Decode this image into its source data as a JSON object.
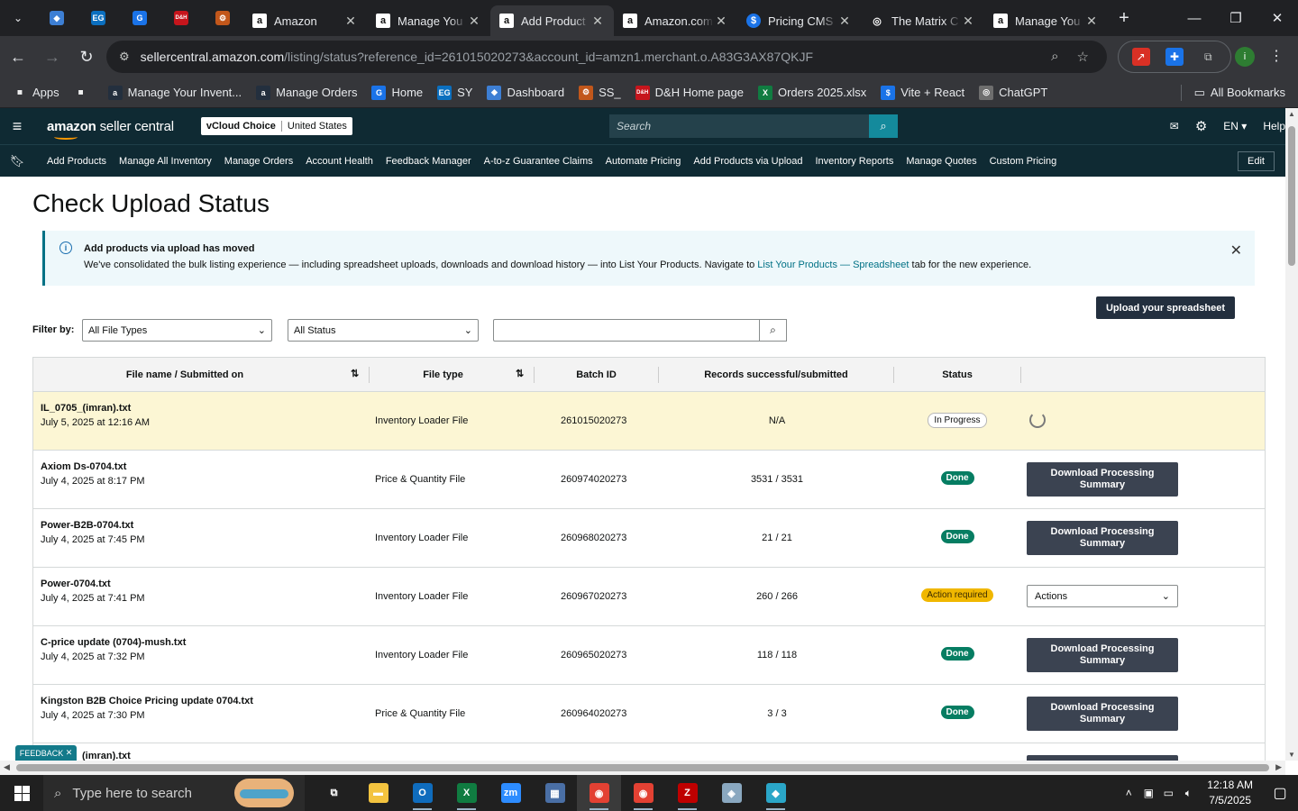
{
  "browser": {
    "tabs": [
      {
        "title": "Amazon",
        "favicon": "amazon-a",
        "active": false
      },
      {
        "title": "Manage You",
        "favicon": "amazon-a",
        "active": false
      },
      {
        "title": "Add Product",
        "favicon": "amazon-a",
        "active": true
      },
      {
        "title": "Amazon.com",
        "favicon": "amazon-a",
        "active": false
      },
      {
        "title": "Pricing CMS",
        "favicon": "dollar-circle",
        "active": false
      },
      {
        "title": "The Matrix C",
        "favicon": "openai",
        "active": false
      },
      {
        "title": "Manage You",
        "favicon": "amazon-a",
        "active": false
      }
    ],
    "pinned_tabs": [
      {
        "name": "pinned-diamond-icon",
        "glyph": "◆",
        "color": "#3d7fd4"
      },
      {
        "name": "pinned-ec-icon",
        "glyph": "EG",
        "color": "#0b6fbf"
      },
      {
        "name": "pinned-g-icon",
        "glyph": "G",
        "color": "#1a73e8"
      },
      {
        "name": "pinned-dh-icon",
        "glyph": "D&H",
        "color": "#c6151c"
      },
      {
        "name": "pinned-ss-icon",
        "glyph": "⚙",
        "color": "#c2571b"
      }
    ],
    "url_host": "sellercentral.amazon.com",
    "url_path": "/listing/status?reference_id=261015020273&account_id=amzn1.merchant.o.A83G3AX87QKJF",
    "bookmarks": [
      {
        "label": "Apps",
        "icon": "grid",
        "color": "#5f6368"
      },
      {
        "label": "",
        "icon": "grid-4",
        "color": "#5f6368"
      },
      {
        "label": "Manage Your Invent...",
        "icon": "a",
        "color": "#232f3e"
      },
      {
        "label": "Manage Orders",
        "icon": "a",
        "color": "#232f3e"
      },
      {
        "label": "Home",
        "icon": "G",
        "color": "#1a73e8"
      },
      {
        "label": "SY",
        "icon": "EG",
        "color": "#0b6fbf"
      },
      {
        "label": "Dashboard",
        "icon": "◆",
        "color": "#3d7fd4"
      },
      {
        "label": "SS_",
        "icon": "⚙",
        "color": "#c2571b"
      },
      {
        "label": "D&H Home page",
        "icon": "D&H",
        "color": "#c6151c"
      },
      {
        "label": "Orders 2025.xlsx",
        "icon": "X",
        "color": "#107c41"
      },
      {
        "label": "Vite + React",
        "icon": "$",
        "color": "#1a73e8"
      },
      {
        "label": "ChatGPT",
        "icon": "◎",
        "color": "#6e6e6e"
      }
    ],
    "all_bookmarks_label": "All Bookmarks"
  },
  "header": {
    "logo_bold": "amazon",
    "logo_rest": " seller central",
    "store_name": "vCloud Choice",
    "marketplace": "United States",
    "search_placeholder": "Search",
    "lang": "EN",
    "help": "Help"
  },
  "nav": {
    "items": [
      "Add Products",
      "Manage All Inventory",
      "Manage Orders",
      "Account Health",
      "Feedback Manager",
      "A-to-z Guarantee Claims",
      "Automate Pricing",
      "Add Products via Upload",
      "Inventory Reports",
      "Manage Quotes",
      "Custom Pricing"
    ],
    "edit": "Edit"
  },
  "page": {
    "title": "Check Upload Status",
    "alert_title": "Add products via upload has moved",
    "alert_body_pre": "We've consolidated the bulk listing experience — including spreadsheet uploads, downloads and download history — into List Your Products. Navigate to ",
    "alert_link": "List Your Products — Spreadsheet",
    "alert_body_post": " tab for the new experience.",
    "upload_button": "Upload your spreadsheet",
    "filter_label": "Filter by:",
    "file_type_filter": "All File Types",
    "status_filter": "All Status",
    "search_value": ""
  },
  "table": {
    "headers": [
      "File name / Submitted on",
      "File type",
      "Batch ID",
      "Records successful/submitted",
      "Status"
    ],
    "rows": [
      {
        "name": "IL_0705_(imran).txt",
        "date": "July 5, 2025 at 12:16 AM",
        "type": "Inventory Loader File",
        "batch": "261015020273",
        "records": "N/A",
        "status": "In Progress",
        "status_kind": "progress",
        "action": "spinner"
      },
      {
        "name": "Axiom Ds-0704.txt",
        "date": "July 4, 2025 at 8:17 PM",
        "type": "Price & Quantity File",
        "batch": "260974020273",
        "records": "3531 / 3531",
        "status": "Done",
        "status_kind": "done",
        "action": "Download Processing Summary"
      },
      {
        "name": "Power-B2B-0704.txt",
        "date": "July 4, 2025 at 7:45 PM",
        "type": "Inventory Loader File",
        "batch": "260968020273",
        "records": "21 / 21",
        "status": "Done",
        "status_kind": "done",
        "action": "Download Processing Summary"
      },
      {
        "name": "Power-0704.txt",
        "date": "July 4, 2025 at 7:41 PM",
        "type": "Inventory Loader File",
        "batch": "260967020273",
        "records": "260 / 266",
        "status": "Action required",
        "status_kind": "action",
        "action": "Actions"
      },
      {
        "name": "C-price update (0704)-mush.txt",
        "date": "July 4, 2025 at 7:32 PM",
        "type": "Inventory Loader File",
        "batch": "260965020273",
        "records": "118 / 118",
        "status": "Done",
        "status_kind": "done",
        "action": "Download Processing Summary"
      },
      {
        "name": "Kingston B2B Choice Pricing update 0704.txt",
        "date": "July 4, 2025 at 7:30 PM",
        "type": "Price & Quantity File",
        "batch": "260964020273",
        "records": "3 / 3",
        "status": "Done",
        "status_kind": "done",
        "action": "Download Processing Summary"
      }
    ],
    "partial_row_name": "(imran).txt"
  },
  "feedback": "FEEDBACK",
  "taskbar": {
    "search_placeholder": "Type here to search",
    "apps": [
      {
        "name": "task-view-icon",
        "glyph": "⧉",
        "color": "transparent",
        "running": false,
        "active": false
      },
      {
        "name": "file-explorer-icon",
        "glyph": "▬",
        "color": "#f3c33f",
        "running": false,
        "active": false
      },
      {
        "name": "outlook-icon",
        "glyph": "O",
        "color": "#0f6cbd",
        "running": true,
        "active": false
      },
      {
        "name": "excel-icon",
        "glyph": "X",
        "color": "#107c41",
        "running": true,
        "active": false
      },
      {
        "name": "zoom-icon",
        "glyph": "zm",
        "color": "#2d8cff",
        "running": false,
        "active": false
      },
      {
        "name": "calculator-icon",
        "glyph": "▦",
        "color": "#4a6fa5",
        "running": false,
        "active": false
      },
      {
        "name": "chrome-icon",
        "glyph": "◉",
        "color": "#e34133",
        "running": true,
        "active": true
      },
      {
        "name": "chrome-profile-icon",
        "glyph": "◉",
        "color": "#e34133",
        "running": true,
        "active": false
      },
      {
        "name": "filezilla-icon",
        "glyph": "Z",
        "color": "#bf0000",
        "running": true,
        "active": false
      },
      {
        "name": "notes-icon",
        "glyph": "◈",
        "color": "#8aa8c0",
        "running": false,
        "active": false
      },
      {
        "name": "app-diamond-icon",
        "glyph": "◆",
        "color": "#2aa6c8",
        "running": true,
        "active": false
      }
    ],
    "time": "12:18 AM",
    "date": "7/5/2025"
  }
}
